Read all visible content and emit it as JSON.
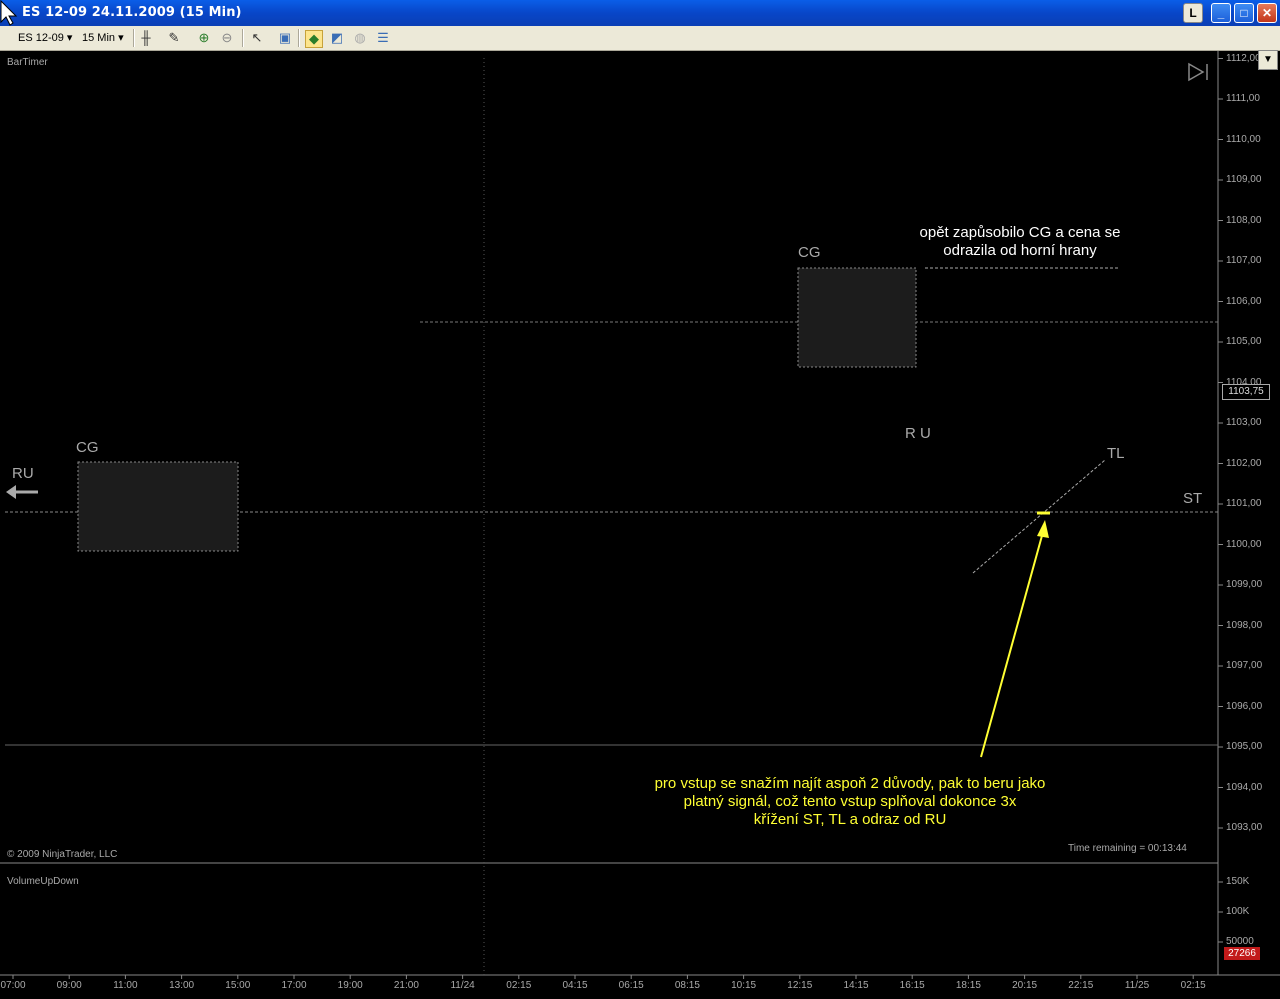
{
  "window": {
    "title": "ES 12-09  24.11.2009 (15 Min)",
    "buttons": [
      "L",
      "_",
      "□",
      "✕"
    ]
  },
  "toolbar": {
    "instrument": "ES 12-09",
    "interval": "15 Min"
  },
  "chart": {
    "indicator_label": "BarTimer",
    "copyright": "© 2009 NinjaTrader, LLC",
    "time_remaining": "Time remaining = 00:13:44",
    "current_price": "1103,75",
    "price_ticks": [
      "1112,00",
      "1111,00",
      "1110,00",
      "1109,00",
      "1108,00",
      "1107,00",
      "1106,00",
      "1105,00",
      "1104,00",
      "1103,00",
      "1102,00",
      "1101,00",
      "1100,00",
      "1099,00",
      "1098,00",
      "1097,00",
      "1096,00",
      "1095,00",
      "1094,00",
      "1093,00"
    ],
    "annotations": {
      "cg_left": "CG",
      "cg_right": "CG",
      "ru_left": "RU",
      "ru_right": "R U",
      "tl": "TL",
      "st": "ST",
      "note_top_line1": "opět zapůsobilo CG a cena se",
      "note_top_line2": "odrazila od horní hrany",
      "note_bottom_line1": "pro vstup se snažím najít aspoň 2 důvody, pak to beru jako",
      "note_bottom_line2": "platný signál, což tento vstup splňoval dokonce 3x",
      "note_bottom_line3": "křížení ST, TL  a odraz od RU"
    }
  },
  "volume_panel": {
    "label": "VolumeUpDown",
    "ticks": [
      "150K",
      "100K",
      "50000"
    ],
    "current": "27266"
  },
  "time_axis": [
    "07:00",
    "09:00",
    "11:00",
    "13:00",
    "15:00",
    "17:00",
    "19:00",
    "21:00",
    "11/24",
    "02:15",
    "04:15",
    "06:15",
    "08:15",
    "10:15",
    "12:15",
    "14:15",
    "16:15",
    "18:15",
    "20:15",
    "22:15",
    "11/25",
    "02:15"
  ],
  "colors": {
    "up_bar": "#9ea94a",
    "down_bar": "#6b6b6b",
    "vol_up": "#1e8b1e",
    "vol_down": "#c21a1a",
    "annotation_yellow": "#ffff33"
  }
}
